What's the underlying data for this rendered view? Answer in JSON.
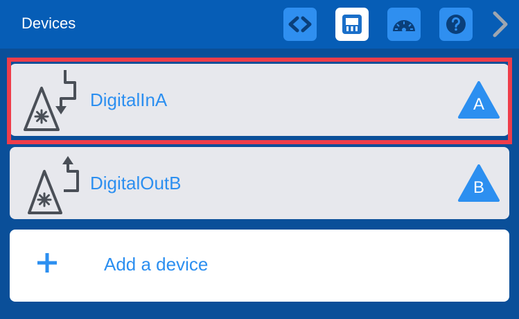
{
  "header": {
    "title": "Devices",
    "buttons": [
      {
        "icon": "code-brackets-icon",
        "active": false
      },
      {
        "icon": "port-icon",
        "active": true
      },
      {
        "icon": "gauge-icon",
        "active": false
      },
      {
        "icon": "help-icon",
        "active": false
      }
    ],
    "next_icon": "chevron-right-icon"
  },
  "devices": [
    {
      "name": "DigitalInA",
      "port": "A",
      "direction": "in",
      "selected": true
    },
    {
      "name": "DigitalOutB",
      "port": "B",
      "direction": "out",
      "selected": false
    }
  ],
  "add_device": {
    "label": "Add a device",
    "icon": "plus-icon"
  },
  "colors": {
    "background": "#0a4f99",
    "header": "#065db6",
    "accent": "#2c8ff0",
    "selected_border": "#ef3d4a",
    "card": "#e7e8ed",
    "icon_dark": "#4a4f57"
  }
}
